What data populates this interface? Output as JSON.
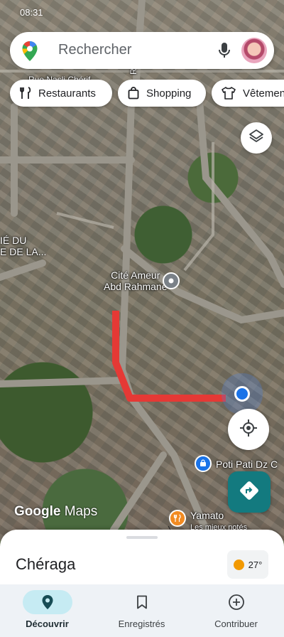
{
  "status_bar": {
    "time": "08:31"
  },
  "search": {
    "placeholder": "Rechercher",
    "icons": [
      "maps-pin-icon",
      "mic-icon",
      "avatar"
    ]
  },
  "chips": [
    {
      "label": "Restaurants",
      "icon": "fork-knife-icon"
    },
    {
      "label": "Shopping",
      "icon": "shopping-bag-icon"
    },
    {
      "label": "Vêtemen",
      "icon": "shirt-icon"
    }
  ],
  "map": {
    "street_labels": [
      "Rue Nasli Chérif",
      "Rue Ahce"
    ],
    "area_label": "IÉ DU\nE DE LA...",
    "places": [
      {
        "name": "Cité Ameur\nAbd Rahmane",
        "icon": "location-pin-icon"
      },
      {
        "name": "Poti Pati Dz C",
        "icon": "shopping-pin-icon"
      },
      {
        "name": "Yamato",
        "subtitle": "Les mieux notés",
        "icon": "restaurant-pin-icon"
      }
    ],
    "logo": {
      "brand": "Google",
      "product": "Maps"
    },
    "colors": {
      "route": "#e53935",
      "location": "#1a73e8",
      "directions": "#137a7f"
    }
  },
  "sheet": {
    "city": "Chéraga",
    "weather": {
      "temperature": "27°"
    }
  },
  "nav": [
    {
      "label": "Découvrir",
      "icon": "explore-pin-icon",
      "active": true
    },
    {
      "label": "Enregistrés",
      "icon": "bookmark-icon",
      "active": false
    },
    {
      "label": "Contribuer",
      "icon": "add-circle-icon",
      "active": false
    }
  ]
}
